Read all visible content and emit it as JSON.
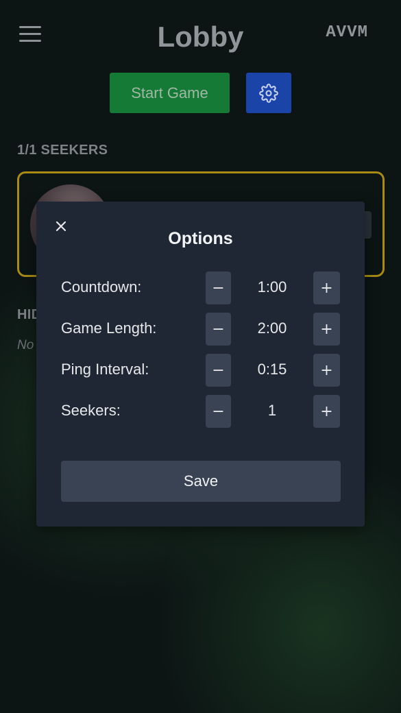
{
  "header": {
    "title": "Lobby",
    "code": "AVVM",
    "menu_icon": "hamburger-menu-icon"
  },
  "actions": {
    "start_label": "Start Game",
    "settings_icon": "gear-icon"
  },
  "seekers": {
    "heading": "1/1 SEEKERS"
  },
  "hiders": {
    "heading": "HIDERS",
    "empty_text": "No hiders"
  },
  "options_modal": {
    "title": "Options",
    "close_icon": "close-icon",
    "rows": [
      {
        "label": "Countdown:",
        "value": "1:00"
      },
      {
        "label": "Game Length:",
        "value": "2:00"
      },
      {
        "label": "Ping Interval:",
        "value": "0:15"
      },
      {
        "label": "Seekers:",
        "value": "1"
      }
    ],
    "minus_symbol": "−",
    "plus_symbol": "+",
    "save_label": "Save"
  },
  "colors": {
    "start_button": "#157a35",
    "settings_button": "#1b44a8",
    "seeker_card_border": "#a98b14",
    "modal_background": "#1f2735"
  }
}
